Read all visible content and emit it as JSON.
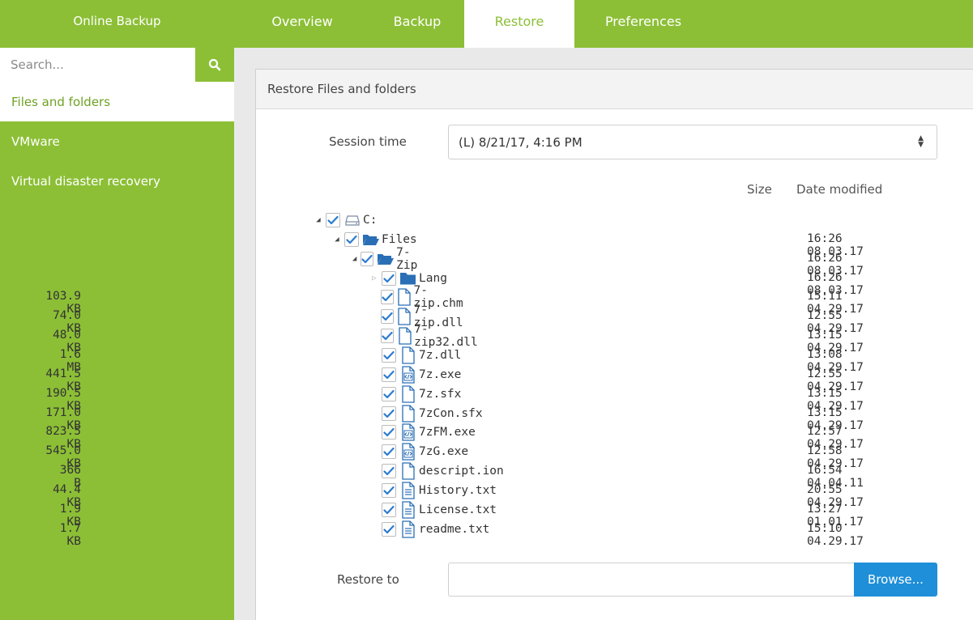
{
  "app": {
    "brand": "Online Backup",
    "tabs": [
      {
        "label": "Overview",
        "active": false
      },
      {
        "label": "Backup",
        "active": false
      },
      {
        "label": "Restore",
        "active": true
      },
      {
        "label": "Preferences",
        "active": false
      }
    ]
  },
  "sidebar": {
    "search_placeholder": "Search...",
    "items": [
      {
        "label": "Files and folders",
        "active": true
      },
      {
        "label": "VMware",
        "active": false
      },
      {
        "label": "Virtual disaster recovery",
        "active": false
      }
    ]
  },
  "panel": {
    "title": "Restore Files and folders",
    "session_label": "Session time",
    "session_value": "(L)  8/21/17, 4:16 PM",
    "col_size": "Size",
    "col_date": "Date modified",
    "restore_label": "Restore to",
    "restore_value": "",
    "browse_label": "Browse..."
  },
  "tree": [
    {
      "name": "C:",
      "type": "drive",
      "level": 0,
      "toggle": "expanded",
      "checked": true,
      "size": "",
      "date": ""
    },
    {
      "name": "Files",
      "type": "folder-open",
      "level": 1,
      "toggle": "expanded",
      "checked": true,
      "size": "",
      "date": "16:26 08.03.17"
    },
    {
      "name": "7-Zip",
      "type": "folder-open",
      "level": 2,
      "toggle": "expanded",
      "checked": true,
      "size": "",
      "date": "16:26 08.03.17"
    },
    {
      "name": "Lang",
      "type": "folder",
      "level": 3,
      "toggle": "collapsed",
      "checked": true,
      "size": "",
      "date": "16:26 08.03.17"
    },
    {
      "name": "7-zip.chm",
      "type": "file",
      "level": 3,
      "toggle": "none",
      "checked": true,
      "size": "103.9 KB",
      "date": "15:11 04.29.17"
    },
    {
      "name": "7-zip.dll",
      "type": "file",
      "level": 3,
      "toggle": "none",
      "checked": true,
      "size": "74.0 KB",
      "date": "12:55 04.29.17"
    },
    {
      "name": "7-zip32.dll",
      "type": "file",
      "level": 3,
      "toggle": "none",
      "checked": true,
      "size": "48.0 KB",
      "date": "13:15 04.29.17"
    },
    {
      "name": "7z.dll",
      "type": "file",
      "level": 3,
      "toggle": "none",
      "checked": true,
      "size": "1.6 MB",
      "date": "13:08 04.29.17"
    },
    {
      "name": "7z.exe",
      "type": "exe",
      "level": 3,
      "toggle": "none",
      "checked": true,
      "size": "441.5 KB",
      "date": "12:55 04.29.17"
    },
    {
      "name": "7z.sfx",
      "type": "file",
      "level": 3,
      "toggle": "none",
      "checked": true,
      "size": "190.5 KB",
      "date": "13:15 04.29.17"
    },
    {
      "name": "7zCon.sfx",
      "type": "file",
      "level": 3,
      "toggle": "none",
      "checked": true,
      "size": "171.0 KB",
      "date": "13:15 04.29.17"
    },
    {
      "name": "7zFM.exe",
      "type": "exe",
      "level": 3,
      "toggle": "none",
      "checked": true,
      "size": "823.5 KB",
      "date": "12:57 04.29.17"
    },
    {
      "name": "7zG.exe",
      "type": "exe",
      "level": 3,
      "toggle": "none",
      "checked": true,
      "size": "545.0 KB",
      "date": "12:58 04.29.17"
    },
    {
      "name": "descript.ion",
      "type": "file",
      "level": 3,
      "toggle": "none",
      "checked": true,
      "size": "366 B",
      "date": "16:54 04.04.11"
    },
    {
      "name": "History.txt",
      "type": "text",
      "level": 3,
      "toggle": "none",
      "checked": true,
      "size": "44.4 KB",
      "date": "20:55 04.29.17"
    },
    {
      "name": "License.txt",
      "type": "text",
      "level": 3,
      "toggle": "none",
      "checked": true,
      "size": "1.9 KB",
      "date": "13:27 01.01.17"
    },
    {
      "name": "readme.txt",
      "type": "text",
      "level": 3,
      "toggle": "none",
      "checked": true,
      "size": "1.7 KB",
      "date": "15:10 04.29.17"
    }
  ],
  "colors": {
    "accent": "#8cbf36",
    "button": "#1e8fd8",
    "icon": "#2a6fb5",
    "check": "#2a7bd0"
  }
}
